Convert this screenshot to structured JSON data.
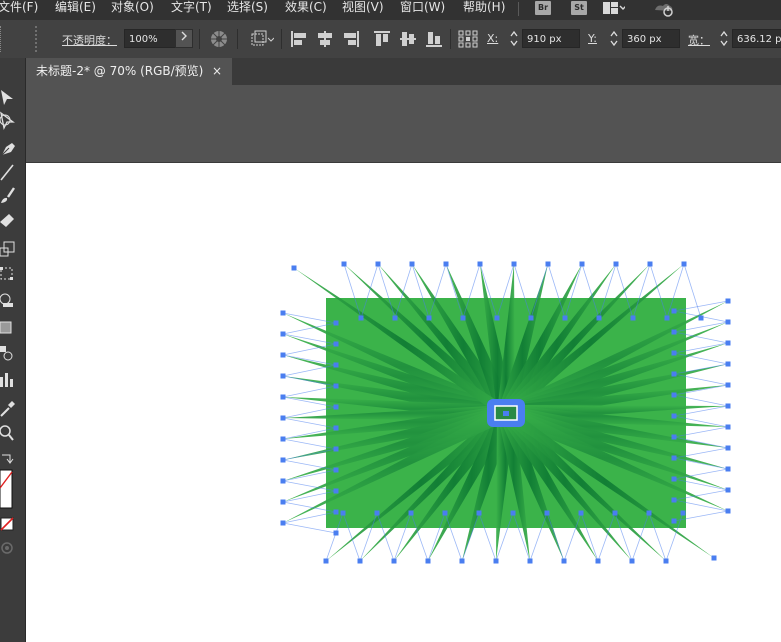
{
  "menu": [
    {
      "label": "文件(F)"
    },
    {
      "label": "编辑(E)"
    },
    {
      "label": "对象(O)"
    },
    {
      "label": "文字(T)"
    },
    {
      "label": "选择(S)"
    },
    {
      "label": "效果(C)"
    },
    {
      "label": "视图(V)"
    },
    {
      "label": "窗口(W)"
    },
    {
      "label": "帮助(H)"
    }
  ],
  "app_badges": {
    "bridge": "Br",
    "stock": "St"
  },
  "control": {
    "opacity_label": "不透明度：",
    "opacity_value": "100%",
    "x_label": "X:",
    "x_value": "910 px",
    "y_label": "Y:",
    "y_value": "360 px",
    "w_label": "宽：",
    "w_value": "636.12 px"
  },
  "document": {
    "tab_title": "未标题-2* @ 70% (RGB/预览)",
    "close_glyph": "×"
  },
  "colors": {
    "art_fill": "#3bb34a",
    "art_dark": "#0f7a34",
    "selection": "#4a7ef0",
    "canvas": "#ffffff"
  },
  "icons": [
    "selection-tool-icon",
    "direct-selection-tool-icon",
    "pen-tool-icon",
    "line-tool-icon",
    "paintbrush-tool-icon",
    "eraser-tool-icon",
    "scale-tool-icon",
    "free-transform-tool-icon",
    "shape-builder-tool-icon",
    "rectangle-tool-icon",
    "symbol-sprayer-tool-icon",
    "column-graph-tool-icon",
    "eyedropper-tool-icon",
    "zoom-tool-icon",
    "swap-colors-icon",
    "fill-stroke-icon",
    "none-color-icon",
    "drawing-mode-icon"
  ]
}
